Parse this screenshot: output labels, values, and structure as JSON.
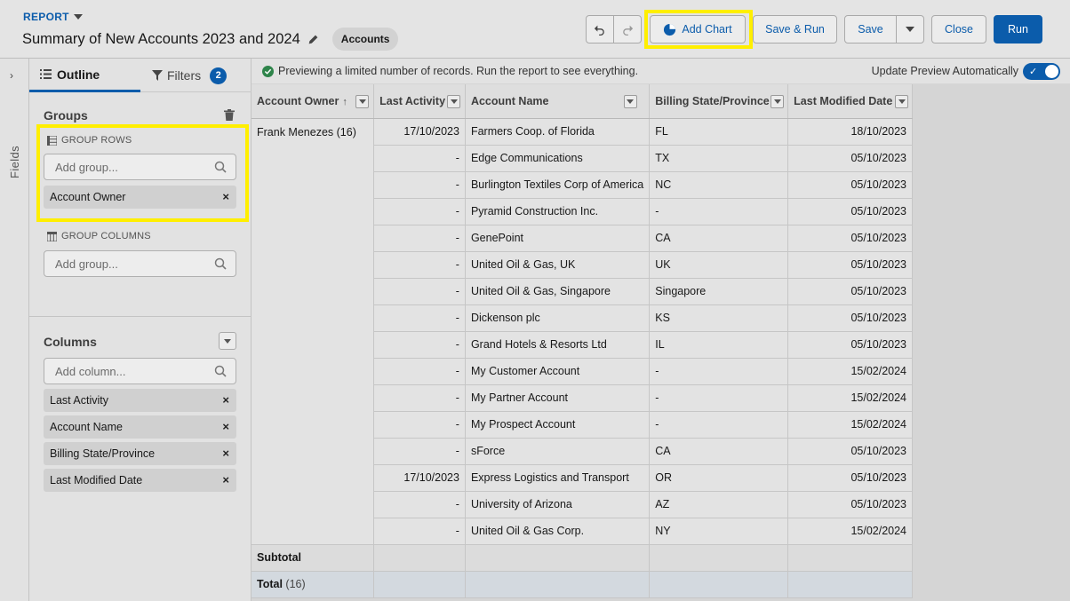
{
  "header": {
    "eyebrow": "REPORT",
    "title": "Summary of New Accounts 2023 and 2024",
    "object_pill": "Accounts",
    "buttons": {
      "add_chart": "Add Chart",
      "save_run": "Save & Run",
      "save": "Save",
      "close": "Close",
      "run": "Run"
    }
  },
  "sidebar": {
    "strip_label": "Fields",
    "tabs": {
      "outline": "Outline",
      "filters": "Filters",
      "filters_count": "2"
    },
    "groups": {
      "title": "Groups",
      "rows_title": "GROUP ROWS",
      "rows_placeholder": "Add group...",
      "rows_items": [
        "Account Owner"
      ],
      "cols_title": "GROUP COLUMNS",
      "cols_placeholder": "Add group..."
    },
    "columns": {
      "title": "Columns",
      "placeholder": "Add column...",
      "items": [
        "Last Activity",
        "Account Name",
        "Billing State/Province",
        "Last Modified Date"
      ]
    }
  },
  "preview": {
    "notice": "Previewing a limited number of records. Run the report to see everything.",
    "auto_label": "Update Preview Automatically",
    "auto_on": true
  },
  "table": {
    "headers": [
      "Account Owner",
      "Last Activity",
      "Account Name",
      "Billing State/Province",
      "Last Modified Date"
    ],
    "group_label": "Frank Menezes",
    "group_count": "(16)",
    "rows": [
      [
        "17/10/2023",
        "Farmers Coop. of Florida",
        "FL",
        "18/10/2023"
      ],
      [
        "-",
        "Edge Communications",
        "TX",
        "05/10/2023"
      ],
      [
        "-",
        "Burlington Textiles Corp of America",
        "NC",
        "05/10/2023"
      ],
      [
        "-",
        "Pyramid Construction Inc.",
        "-",
        "05/10/2023"
      ],
      [
        "-",
        "GenePoint",
        "CA",
        "05/10/2023"
      ],
      [
        "-",
        "United Oil & Gas, UK",
        "UK",
        "05/10/2023"
      ],
      [
        "-",
        "United Oil & Gas, Singapore",
        "Singapore",
        "05/10/2023"
      ],
      [
        "-",
        "Dickenson plc",
        "KS",
        "05/10/2023"
      ],
      [
        "-",
        "Grand Hotels & Resorts Ltd",
        "IL",
        "05/10/2023"
      ],
      [
        "-",
        "My Customer Account",
        "-",
        "15/02/2024"
      ],
      [
        "-",
        "My Partner Account",
        "-",
        "15/02/2024"
      ],
      [
        "-",
        "My Prospect Account",
        "-",
        "15/02/2024"
      ],
      [
        "-",
        "sForce",
        "CA",
        "05/10/2023"
      ],
      [
        "17/10/2023",
        "Express Logistics and Transport",
        "OR",
        "05/10/2023"
      ],
      [
        "-",
        "University of Arizona",
        "AZ",
        "05/10/2023"
      ],
      [
        "-",
        "United Oil & Gas Corp.",
        "NY",
        "15/02/2024"
      ]
    ],
    "subtotal_label": "Subtotal",
    "total_label": "Total",
    "total_count": "(16)"
  },
  "colors": {
    "brand": "#0b5cab",
    "highlight": "#ffef00",
    "success": "#2e844a"
  }
}
